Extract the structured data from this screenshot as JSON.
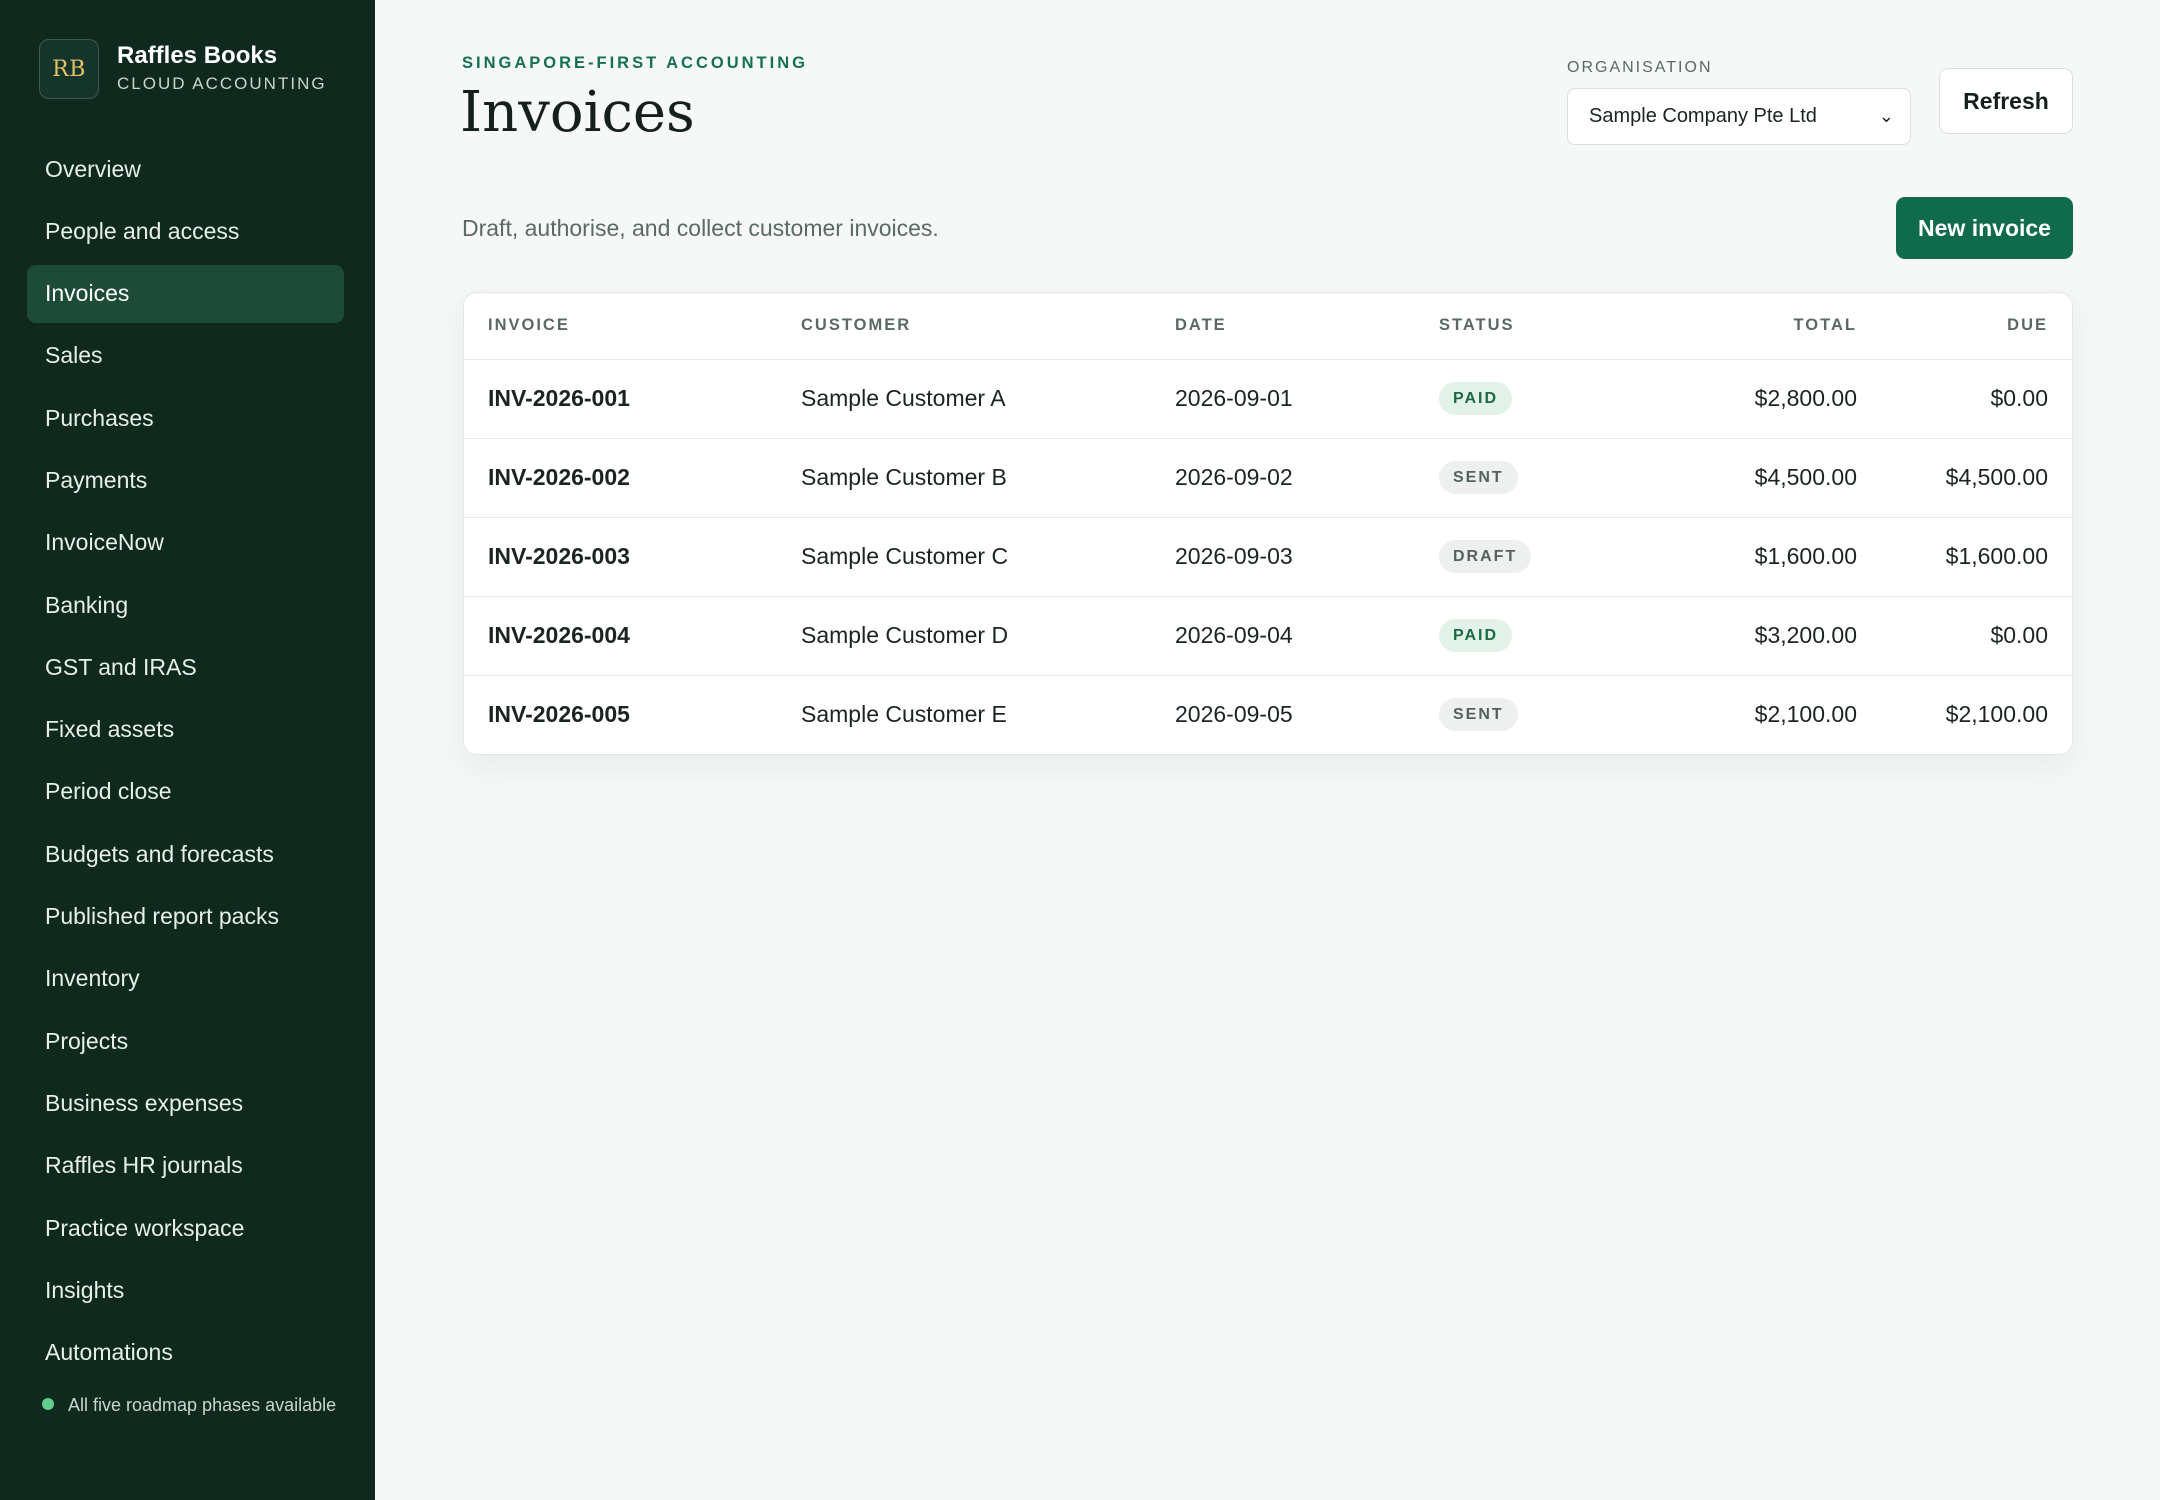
{
  "brand": {
    "mark": "RB",
    "name": "Raffles Books",
    "sub": "CLOUD ACCOUNTING"
  },
  "nav": [
    {
      "label": "Overview",
      "active": false
    },
    {
      "label": "People and access",
      "active": false
    },
    {
      "label": "Invoices",
      "active": true
    },
    {
      "label": "Sales",
      "active": false
    },
    {
      "label": "Purchases",
      "active": false
    },
    {
      "label": "Payments",
      "active": false
    },
    {
      "label": "InvoiceNow",
      "active": false
    },
    {
      "label": "Banking",
      "active": false
    },
    {
      "label": "GST and IRAS",
      "active": false
    },
    {
      "label": "Fixed assets",
      "active": false
    },
    {
      "label": "Period close",
      "active": false
    },
    {
      "label": "Budgets and forecasts",
      "active": false
    },
    {
      "label": "Published report packs",
      "active": false
    },
    {
      "label": "Inventory",
      "active": false
    },
    {
      "label": "Projects",
      "active": false
    },
    {
      "label": "Business expenses",
      "active": false
    },
    {
      "label": "Raffles HR journals",
      "active": false
    },
    {
      "label": "Practice workspace",
      "active": false
    },
    {
      "label": "Insights",
      "active": false
    },
    {
      "label": "Automations",
      "active": false
    }
  ],
  "footer": {
    "status_text": "All five roadmap phases available",
    "status_color": "#5fd08f"
  },
  "header": {
    "eyebrow": "SINGAPORE-FIRST ACCOUNTING",
    "title": "Invoices",
    "subtitle": "Draft, authorise, and collect customer invoices.",
    "org_label": "ORGANISATION",
    "org_selected": "Sample Company Pte Ltd",
    "refresh_label": "Refresh",
    "new_label": "New invoice"
  },
  "table": {
    "columns": {
      "invoice": "INVOICE",
      "customer": "CUSTOMER",
      "date": "DATE",
      "status": "STATUS",
      "total": "TOTAL",
      "due": "DUE"
    },
    "rows": [
      {
        "invoice": "INV-2026-001",
        "customer": "Sample Customer A",
        "date": "2026-09-01",
        "status": "PAID",
        "total": "$2,800.00",
        "due": "$0.00"
      },
      {
        "invoice": "INV-2026-002",
        "customer": "Sample Customer B",
        "date": "2026-09-02",
        "status": "SENT",
        "total": "$4,500.00",
        "due": "$4,500.00"
      },
      {
        "invoice": "INV-2026-003",
        "customer": "Sample Customer C",
        "date": "2026-09-03",
        "status": "DRAFT",
        "total": "$1,600.00",
        "due": "$1,600.00"
      },
      {
        "invoice": "INV-2026-004",
        "customer": "Sample Customer D",
        "date": "2026-09-04",
        "status": "PAID",
        "total": "$3,200.00",
        "due": "$0.00"
      },
      {
        "invoice": "INV-2026-005",
        "customer": "Sample Customer E",
        "date": "2026-09-05",
        "status": "SENT",
        "total": "$2,100.00",
        "due": "$2,100.00"
      }
    ]
  },
  "colors": {
    "sidebar": "#10291f",
    "accent": "#0f6b4b",
    "eyebrow": "#14704e",
    "brand_mark": "#e3c06a"
  }
}
